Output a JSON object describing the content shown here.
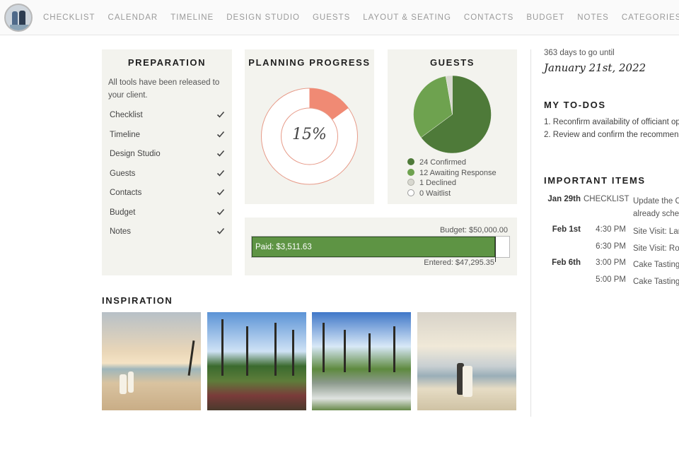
{
  "nav": {
    "items": [
      "CHECKLIST",
      "CALENDAR",
      "TIMELINE",
      "DESIGN STUDIO",
      "GUESTS",
      "LAYOUT & SEATING",
      "CONTACTS",
      "BUDGET",
      "NOTES",
      "CATEGORIES"
    ]
  },
  "preparation": {
    "title": "PREPARATION",
    "intro": "All tools have been released to your client.",
    "items": [
      "Checklist",
      "Timeline",
      "Design Studio",
      "Guests",
      "Contacts",
      "Budget",
      "Notes"
    ]
  },
  "progress": {
    "title": "PLANNING PROGRESS",
    "percent_label": "15%",
    "percent": 15,
    "accent_color": "#f08a74"
  },
  "guests": {
    "title": "GUESTS",
    "legend": [
      "24 Confirmed",
      "12 Awaiting Response",
      "1 Declined",
      "0 Waitlist"
    ],
    "counts": [
      24,
      12,
      1,
      0
    ],
    "colors": [
      "#4e7a39",
      "#6ea24f",
      "#d8d8d0",
      "#ffffff"
    ]
  },
  "budget": {
    "budget_label": "Budget: $50,000.00",
    "paid_label": "Paid: $3,511.63",
    "entered_label": "Entered: $47,295.35",
    "budget_total": 50000,
    "paid": 3511.63,
    "entered": 47295.35,
    "bar_color": "#5e9444"
  },
  "inspiration": {
    "title": "INSPIRATION"
  },
  "countdown": {
    "text": "363 days to go until",
    "date": "January 21st, 2022"
  },
  "todos": {
    "title": "MY TO-DOS",
    "items": [
      "1. Reconfirm availability of officiant op",
      "2. Review and confirm the recommen"
    ]
  },
  "important": {
    "title": "IMPORTANT ITEMS",
    "rows": [
      {
        "date": "Jan 29th",
        "time": "CHECKLIST",
        "desc": "Update the C",
        "desc2": "already sche"
      },
      {
        "date": "Feb 1st",
        "time": "4:30 PM",
        "desc": "Site Visit: Lan",
        "desc2": ""
      },
      {
        "date": "",
        "time": "6:30 PM",
        "desc": "Site Visit: Roy",
        "desc2": ""
      },
      {
        "date": "Feb 6th",
        "time": "3:00 PM",
        "desc": "Cake Tasting:",
        "desc2": ""
      },
      {
        "date": "",
        "time": "5:00 PM",
        "desc": "Cake Tasting:",
        "desc2": ""
      }
    ]
  }
}
